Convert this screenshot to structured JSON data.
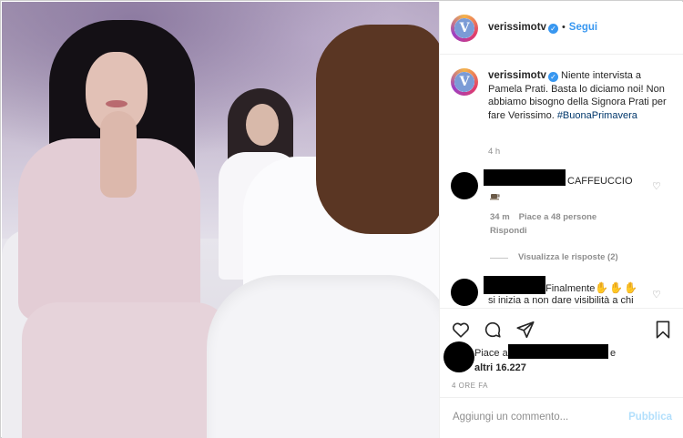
{
  "post": {
    "username": "verissimotv",
    "follow_label": "Segui",
    "separator": "•",
    "avatar_letter": "V",
    "verified_icon": "verified-check-icon"
  },
  "caption": {
    "username": "verissimotv",
    "text": "Niente intervista a Pamela Prati. Basta lo diciamo noi! Non abbiamo bisogno della Signora Prati per fare Verissimo.",
    "hashtag": "#BuonaPrimavera",
    "time": "4 h"
  },
  "comments": [
    {
      "text": "CAFFEUCCIO",
      "emoji": "coffee-icon",
      "time": "34 m",
      "likes": "Piace a 48 persone",
      "reply_label": "Rispondi",
      "view_replies": "Visualizza le risposte (2)"
    },
    {
      "text_line1": "Finalmente",
      "emoji": "clapping-hands-icon",
      "text_line2": "si inizia a non dare visibilità a chi"
    }
  ],
  "likes": {
    "prefix": "Piace a",
    "suffix": "e",
    "others": "altri 16.227"
  },
  "posted_ago": "4 ORE FA",
  "add_comment": {
    "placeholder": "Aggiungi un commento...",
    "publish_label": "Pubblica"
  },
  "colors": {
    "accent_blue": "#3897f0",
    "publish_disabled": "#b2dffc",
    "hashtag": "#00376b",
    "muted": "#8e8e8e"
  }
}
